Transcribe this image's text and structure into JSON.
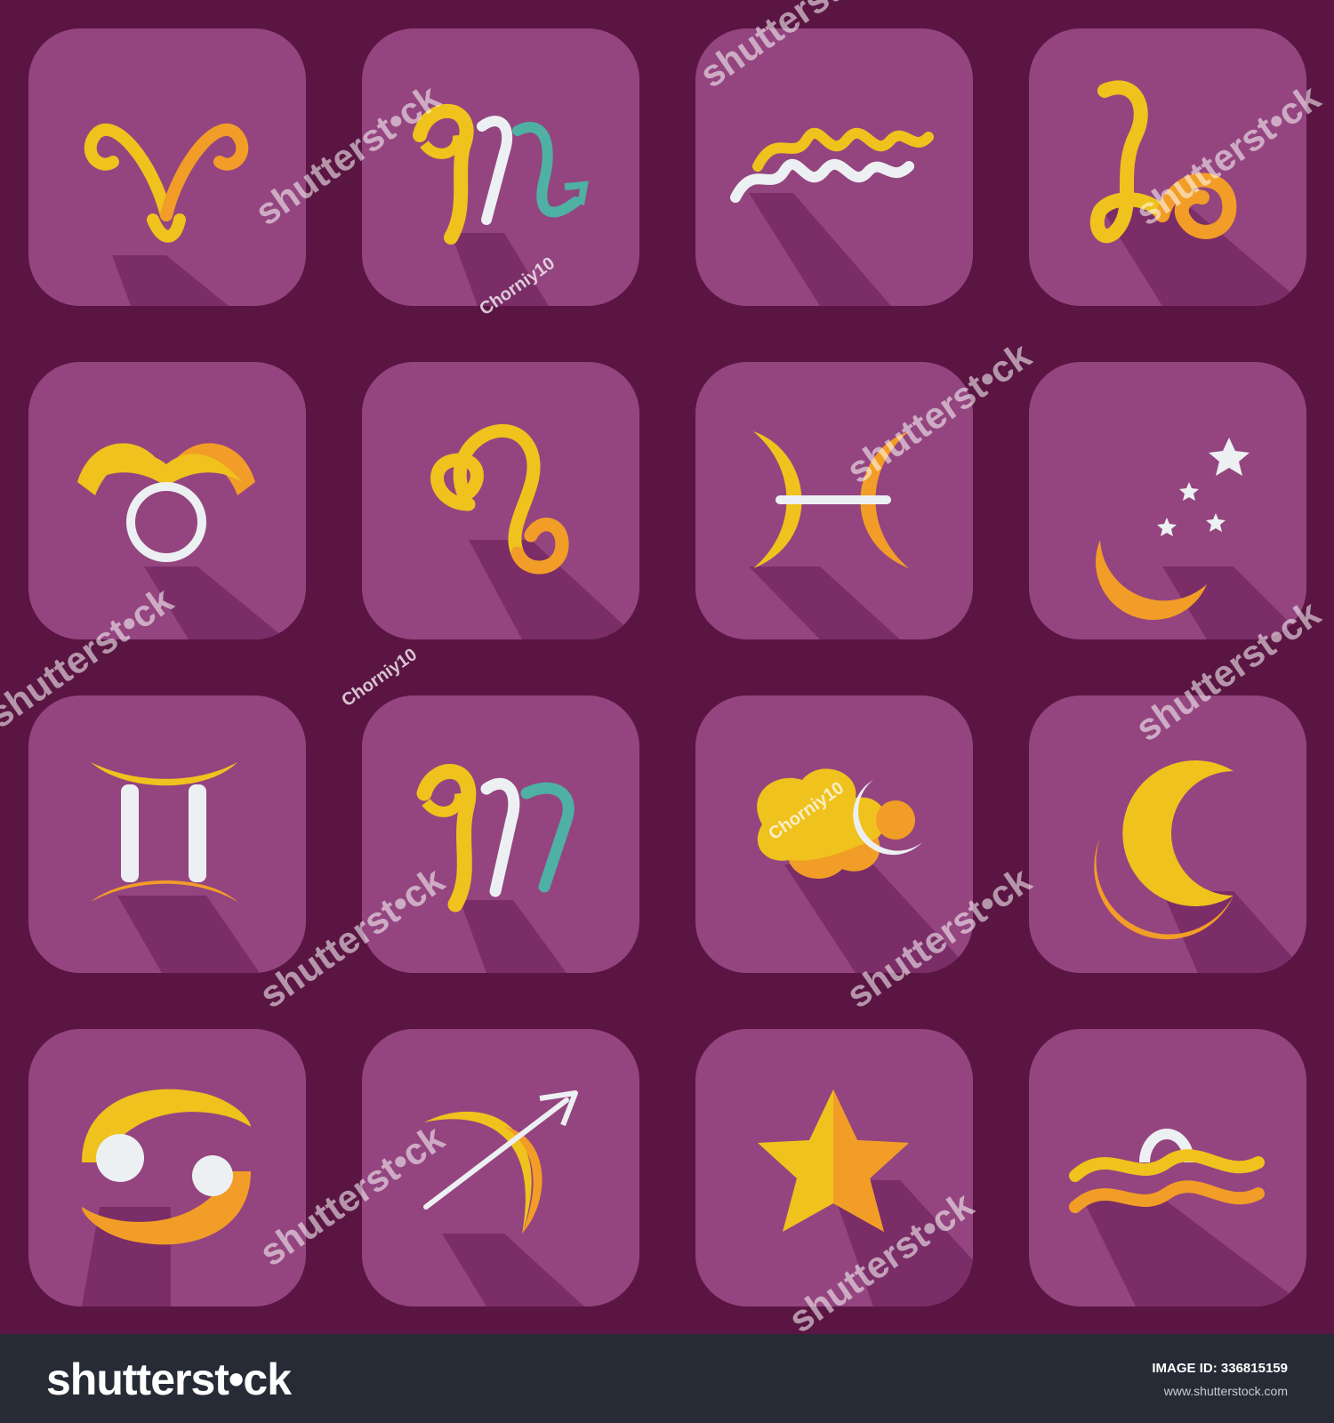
{
  "colors": {
    "background": "#5b1543",
    "tile": "#94457f",
    "shadow": "#7a2d67",
    "yellow": "#f0c21d",
    "orange": "#f29d27",
    "white": "#ecf0f2",
    "teal": "#4fb0a4",
    "footer": "#262b35"
  },
  "grid": {
    "rows": 4,
    "columns": 4
  },
  "icons": [
    {
      "name": "aries-icon"
    },
    {
      "name": "scorpio-icon"
    },
    {
      "name": "aquarius-icon"
    },
    {
      "name": "capricorn-icon"
    },
    {
      "name": "taurus-icon"
    },
    {
      "name": "leo-icon"
    },
    {
      "name": "pisces-icon"
    },
    {
      "name": "moon-stars-icon"
    },
    {
      "name": "gemini-icon"
    },
    {
      "name": "virgo-icon"
    },
    {
      "name": "cloud-moon-icon"
    },
    {
      "name": "crescent-moon-icon"
    },
    {
      "name": "cancer-icon"
    },
    {
      "name": "sagittarius-icon"
    },
    {
      "name": "star-icon"
    },
    {
      "name": "libra-icon"
    }
  ],
  "watermark": {
    "brand": "shutterst•ck",
    "author": "Chorniy10"
  },
  "footer": {
    "logo": "shutterst•ck",
    "image_id_label": "IMAGE ID:",
    "image_id": "336815159",
    "url": "www.shutterstock.com"
  }
}
